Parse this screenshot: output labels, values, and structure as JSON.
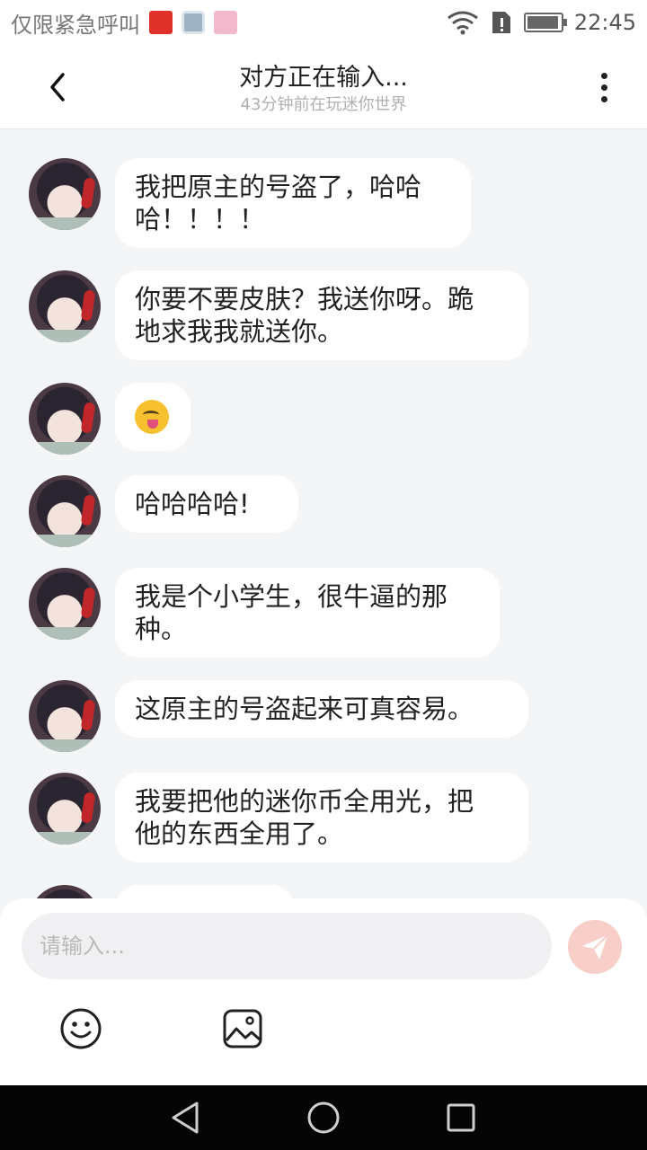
{
  "status_bar": {
    "left_text": "仅限紧急呼叫",
    "time": "22:45",
    "battery_level": 0.95,
    "icons": [
      "red-packet-icon",
      "gallery-icon",
      "pink-app-icon",
      "wifi-icon",
      "sim-alert-icon",
      "battery-icon"
    ]
  },
  "header": {
    "title": "对方正在输入...",
    "subtitle": "43分钟前在玩迷你世界",
    "back_icon": "chevron-left-icon",
    "more_icon": "more-vertical-icon"
  },
  "messages": [
    {
      "line1": "我把原主的号盗了，哈哈",
      "line2": "哈！！！！"
    },
    {
      "line1": "你要不要皮肤？我送你呀。跪",
      "line2": "地求我我就送你。"
    },
    {
      "emoji": "tongue-out-squint-emoji"
    },
    {
      "line1": "哈哈哈哈!",
      "line2": ""
    },
    {
      "line1": "我是个小学生，很牛逼的那",
      "line2": "种。"
    },
    {
      "line1": "这原主的号盗起来可真容易。",
      "line2": ""
    },
    {
      "line1": "我要把他的迷你币全用光，把",
      "line2": "他的东西全用了。"
    }
  ],
  "input": {
    "placeholder": "请输入...",
    "value": "",
    "send_icon": "send-icon",
    "emoji_button_icon": "smiley-icon",
    "image_button_icon": "image-icon"
  },
  "nav_bar": {
    "icons": [
      "back-triangle-icon",
      "home-circle-icon",
      "recents-square-icon"
    ]
  },
  "colors": {
    "background": "#f4f5f7",
    "bubble": "#ffffff",
    "send_button": "#f7cfc8",
    "nav_bar": "#050505"
  }
}
